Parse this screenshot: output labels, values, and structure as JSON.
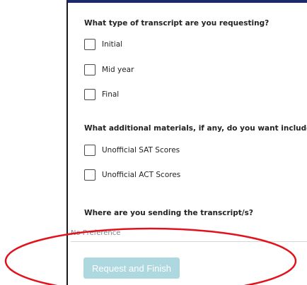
{
  "form": {
    "transcript_type": {
      "question": "What type of transcript are you requesting?",
      "options": [
        {
          "label": "Initial",
          "checked": false
        },
        {
          "label": "Mid year",
          "checked": false
        },
        {
          "label": "Final",
          "checked": false
        }
      ]
    },
    "additional_materials": {
      "question": "What additional materials, if any, do you want included?",
      "options": [
        {
          "label": "Unofficial SAT Scores",
          "checked": false
        },
        {
          "label": "Unofficial ACT Scores",
          "checked": false
        }
      ]
    },
    "destination": {
      "question": "Where are you sending the transcript/s?",
      "selected": "No Preference"
    },
    "submit_label": "Request and Finish"
  },
  "colors": {
    "panel_top_border": "#1c2a6b",
    "submit_button": "#aed8df",
    "annotation_ellipse": "#e3111b"
  }
}
